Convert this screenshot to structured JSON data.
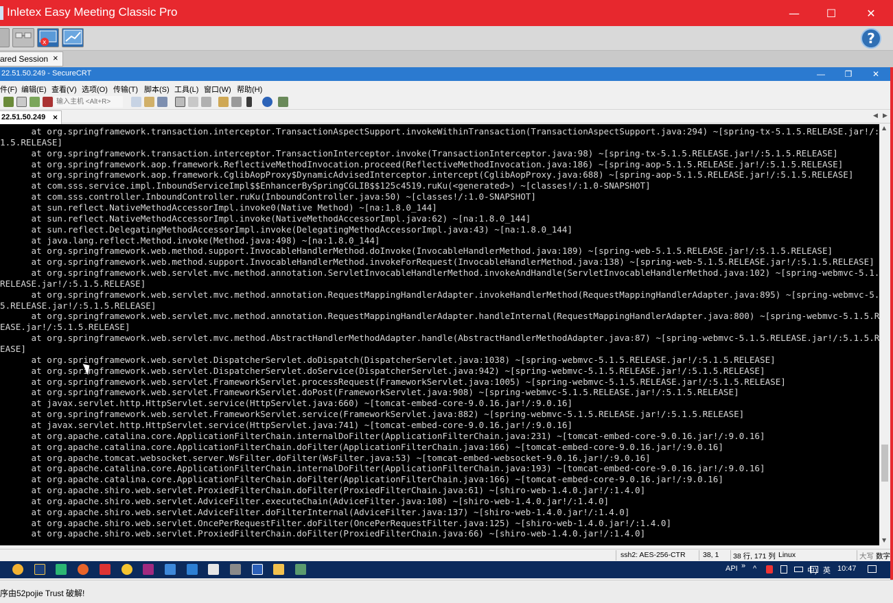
{
  "outer_window": {
    "title": "Inletex Easy Meeting Classic Pro",
    "minimize": "—",
    "maximize": "☐",
    "close": "✕"
  },
  "meeting_toolbar": {
    "help_label": "?"
  },
  "session_tab": {
    "label": "ared Session",
    "close": "×"
  },
  "securecrt": {
    "title": "22.51.50.249 - SecureCRT",
    "buttons": {
      "minimize": "—",
      "restore": "❐",
      "close": "✕"
    },
    "menu": [
      "件(F)",
      "编辑(E)",
      "查看(V)",
      "选项(O)",
      "传输(T)",
      "脚本(S)",
      "工具(L)",
      "窗口(W)",
      "帮助(H)"
    ],
    "host_placeholder": "输入主机 <Alt+R>",
    "tab_label": "22.51.50.249",
    "tab_close": "×"
  },
  "terminal_lines": [
    "      at org.springframework.transaction.interceptor.TransactionAspectSupport.invokeWithinTransaction(TransactionAspectSupport.java:294) ~[spring-tx-5.1.5.RELEASE.jar!/:",
    "1.5.RELEASE]",
    "      at org.springframework.transaction.interceptor.TransactionInterceptor.invoke(TransactionInterceptor.java:98) ~[spring-tx-5.1.5.RELEASE.jar!/:5.1.5.RELEASE]",
    "      at org.springframework.aop.framework.ReflectiveMethodInvocation.proceed(ReflectiveMethodInvocation.java:186) ~[spring-aop-5.1.5.RELEASE.jar!/:5.1.5.RELEASE]",
    "      at org.springframework.aop.framework.CglibAopProxy$DynamicAdvisedInterceptor.intercept(CglibAopProxy.java:688) ~[spring-aop-5.1.5.RELEASE.jar!/:5.1.5.RELEASE]",
    "      at com.sss.service.impl.InboundServiceImpl$$EnhancerBySpringCGLIB$$125c4519.ruKu(<generated>) ~[classes!/:1.0-SNAPSHOT]",
    "      at com.sss.controller.InboundController.ruKu(InboundController.java:50) ~[classes!/:1.0-SNAPSHOT]",
    "      at sun.reflect.NativeMethodAccessorImpl.invoke0(Native Method) ~[na:1.8.0_144]",
    "      at sun.reflect.NativeMethodAccessorImpl.invoke(NativeMethodAccessorImpl.java:62) ~[na:1.8.0_144]",
    "      at sun.reflect.DelegatingMethodAccessorImpl.invoke(DelegatingMethodAccessorImpl.java:43) ~[na:1.8.0_144]",
    "      at java.lang.reflect.Method.invoke(Method.java:498) ~[na:1.8.0_144]",
    "      at org.springframework.web.method.support.InvocableHandlerMethod.doInvoke(InvocableHandlerMethod.java:189) ~[spring-web-5.1.5.RELEASE.jar!/:5.1.5.RELEASE]",
    "      at org.springframework.web.method.support.InvocableHandlerMethod.invokeForRequest(InvocableHandlerMethod.java:138) ~[spring-web-5.1.5.RELEASE.jar!/:5.1.5.RELEASE]",
    "      at org.springframework.web.servlet.mvc.method.annotation.ServletInvocableHandlerMethod.invokeAndHandle(ServletInvocableHandlerMethod.java:102) ~[spring-webmvc-5.1.",
    "RELEASE.jar!/:5.1.5.RELEASE]",
    "      at org.springframework.web.servlet.mvc.method.annotation.RequestMappingHandlerAdapter.invokeHandlerMethod(RequestMappingHandlerAdapter.java:895) ~[spring-webmvc-5.",
    "5.RELEASE.jar!/:5.1.5.RELEASE]",
    "      at org.springframework.web.servlet.mvc.method.annotation.RequestMappingHandlerAdapter.handleInternal(RequestMappingHandlerAdapter.java:800) ~[spring-webmvc-5.1.5.R",
    "EASE.jar!/:5.1.5.RELEASE]",
    "      at org.springframework.web.servlet.mvc.method.AbstractHandlerMethodAdapter.handle(AbstractHandlerMethodAdapter.java:87) ~[spring-webmvc-5.1.5.RELEASE.jar!/:5.1.5.R",
    "EASE]",
    "      at org.springframework.web.servlet.DispatcherServlet.doDispatch(DispatcherServlet.java:1038) ~[spring-webmvc-5.1.5.RELEASE.jar!/:5.1.5.RELEASE]",
    "      at org.springframework.web.servlet.DispatcherServlet.doService(DispatcherServlet.java:942) ~[spring-webmvc-5.1.5.RELEASE.jar!/:5.1.5.RELEASE]",
    "      at org.springframework.web.servlet.FrameworkServlet.processRequest(FrameworkServlet.java:1005) ~[spring-webmvc-5.1.5.RELEASE.jar!/:5.1.5.RELEASE]",
    "      at org.springframework.web.servlet.FrameworkServlet.doPost(FrameworkServlet.java:908) ~[spring-webmvc-5.1.5.RELEASE.jar!/:5.1.5.RELEASE]",
    "      at javax.servlet.http.HttpServlet.service(HttpServlet.java:660) ~[tomcat-embed-core-9.0.16.jar!/:9.0.16]",
    "      at org.springframework.web.servlet.FrameworkServlet.service(FrameworkServlet.java:882) ~[spring-webmvc-5.1.5.RELEASE.jar!/:5.1.5.RELEASE]",
    "      at javax.servlet.http.HttpServlet.service(HttpServlet.java:741) ~[tomcat-embed-core-9.0.16.jar!/:9.0.16]",
    "      at org.apache.catalina.core.ApplicationFilterChain.internalDoFilter(ApplicationFilterChain.java:231) ~[tomcat-embed-core-9.0.16.jar!/:9.0.16]",
    "      at org.apache.catalina.core.ApplicationFilterChain.doFilter(ApplicationFilterChain.java:166) ~[tomcat-embed-core-9.0.16.jar!/:9.0.16]",
    "      at org.apache.tomcat.websocket.server.WsFilter.doFilter(WsFilter.java:53) ~[tomcat-embed-websocket-9.0.16.jar!/:9.0.16]",
    "      at org.apache.catalina.core.ApplicationFilterChain.internalDoFilter(ApplicationFilterChain.java:193) ~[tomcat-embed-core-9.0.16.jar!/:9.0.16]",
    "      at org.apache.catalina.core.ApplicationFilterChain.doFilter(ApplicationFilterChain.java:166) ~[tomcat-embed-core-9.0.16.jar!/:9.0.16]",
    "      at org.apache.shiro.web.servlet.ProxiedFilterChain.doFilter(ProxiedFilterChain.java:61) ~[shiro-web-1.4.0.jar!/:1.4.0]",
    "      at org.apache.shiro.web.servlet.AdviceFilter.executeChain(AdviceFilter.java:108) ~[shiro-web-1.4.0.jar!/:1.4.0]",
    "      at org.apache.shiro.web.servlet.AdviceFilter.doFilterInternal(AdviceFilter.java:137) ~[shiro-web-1.4.0.jar!/:1.4.0]",
    "      at org.apache.shiro.web.servlet.OncePerRequestFilter.doFilter(OncePerRequestFilter.java:125) ~[shiro-web-1.4.0.jar!/:1.4.0]",
    "      at org.apache.shiro.web.servlet.ProxiedFilterChain.doFilter(ProxiedFilterChain.java:66) ~[shiro-web-1.4.0.jar!/:1.4.0]"
  ],
  "status_bar": {
    "encryption": "ssh2: AES-256-CTR",
    "cursor_pos": "38,  1",
    "size": "38 行, 171 列",
    "os": "Linux",
    "caps": "大写",
    "num": "数字"
  },
  "taskbar": {
    "api_label": "API",
    "chevron": "»",
    "caret": "^",
    "volume": "中)",
    "ime": "英",
    "time": "10:47"
  },
  "footer": {
    "text": "序由52pojie Trust 破解!"
  }
}
